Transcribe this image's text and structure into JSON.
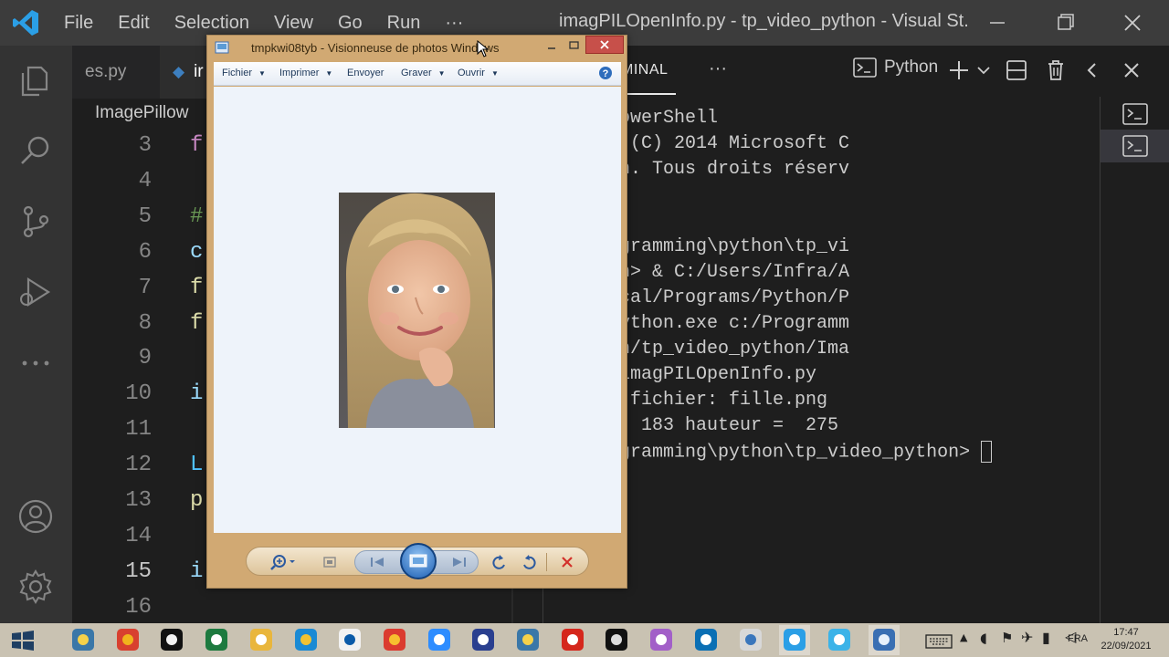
{
  "vscode": {
    "menu": [
      "File",
      "Edit",
      "Selection",
      "View",
      "Go",
      "Run",
      "···"
    ],
    "window_title": "imagPILOpenInfo.py - tp_video_python - Visual St...",
    "tabs": [
      {
        "label": "es.py",
        "icon": "python-file-icon"
      },
      {
        "label": "ir",
        "icon": "python-file-icon"
      }
    ],
    "breadcrumb": "ImagePillow",
    "editor": {
      "lines": [
        {
          "num": "3",
          "code": "f",
          "color": "#c586c0"
        },
        {
          "num": "4",
          "code": "",
          "color": "#cccccc"
        },
        {
          "num": "5",
          "code": "#",
          "color": "#6a9955"
        },
        {
          "num": "6",
          "code": "c",
          "color": "#9cdcfe"
        },
        {
          "num": "7",
          "code": "f",
          "color": "#dcdcaa"
        },
        {
          "num": "8",
          "code": "f",
          "color": "#dcdcaa"
        },
        {
          "num": "9",
          "code": "",
          "color": "#cccccc"
        },
        {
          "num": "10",
          "code": "i",
          "color": "#9cdcfe"
        },
        {
          "num": "11",
          "code": "",
          "color": "#cccccc"
        },
        {
          "num": "12",
          "code": "L",
          "color": "#4fc1ff"
        },
        {
          "num": "13",
          "code": "p",
          "color": "#dcdcaa"
        },
        {
          "num": "14",
          "code": "",
          "color": "#cccccc"
        },
        {
          "num": "15",
          "code": "i",
          "color": "#9cdcfe"
        },
        {
          "num": "16",
          "code": "",
          "color": "#cccccc"
        }
      ],
      "active_line": "15"
    },
    "panel": {
      "terminal_tab": "MINAL",
      "more": "···",
      "shell_label": "Python"
    },
    "terminal_lines": [
      "ows PowerShell",
      "right (C) 2014 Microsoft C",
      "ration. Tous droits réserv",
      "",
      "",
      ":\\Programming\\python\\tp_vi",
      "python> & C:/Users/Infra/A",
      "ta/Local/Programs/Python/P",
      "n38/python.exe c:/Programm",
      "python/tp_video_python/Ima",
      "llow/imagPILOpenInfo.py",
      "om du fichier: fille.png",
      "eur =  183 hauteur =  275",
      ":\\Programming\\python\\tp_video_python> "
    ]
  },
  "viewer": {
    "title": "tmpkwi08tyb - Visionneuse de photos Windows",
    "menu": [
      "Fichier",
      "Imprimer",
      "Envoyer",
      "Graver",
      "Ouvrir"
    ],
    "menu_has_dropdown": [
      true,
      true,
      false,
      true,
      true
    ]
  },
  "taskbar": {
    "lang": "FRA",
    "time": "17:47",
    "date": "22/09/2021"
  }
}
